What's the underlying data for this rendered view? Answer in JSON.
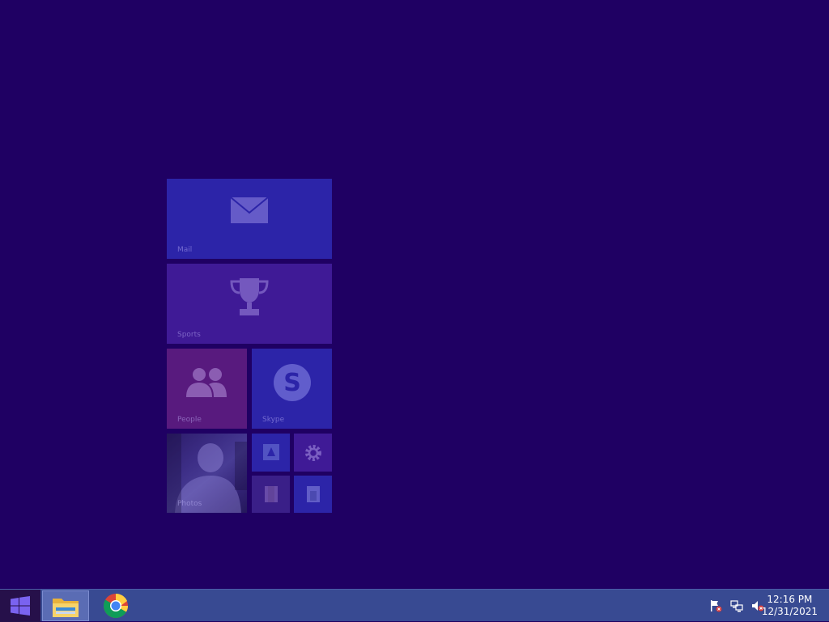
{
  "tiles": {
    "mail": {
      "label": "Mail",
      "icon": "mail-icon"
    },
    "sports": {
      "label": "Sports",
      "icon": "trophy-icon"
    },
    "people": {
      "label": "People",
      "icon": "people-icon"
    },
    "skype": {
      "label": "Skype",
      "icon": "skype-icon"
    },
    "photos": {
      "label": "Photos",
      "icon": "photo-image"
    },
    "small1": {
      "icon": "desktop-app-icon"
    },
    "small2": {
      "icon": "gear-icon"
    },
    "small3": {
      "icon": "folder-icon"
    },
    "small4": {
      "icon": "folder-icon"
    }
  },
  "taskbar": {
    "start_icon": "windows-logo-icon",
    "apps": [
      {
        "name": "File Explorer",
        "icon": "folder-icon",
        "active": true
      },
      {
        "name": "Google Chrome",
        "icon": "chrome-icon",
        "active": false
      }
    ]
  },
  "tray": {
    "icons": [
      "action-center-flag-icon",
      "network-icon",
      "volume-muted-icon"
    ],
    "time": "12:16 PM",
    "date": "12/31/2021"
  },
  "colors": {
    "desktop_background": "#1f0063",
    "taskbar": "#384a92",
    "tile_blue": "#2c24a8",
    "tile_purple": "#3f1a96",
    "tile_magenta": "#581a7e"
  }
}
